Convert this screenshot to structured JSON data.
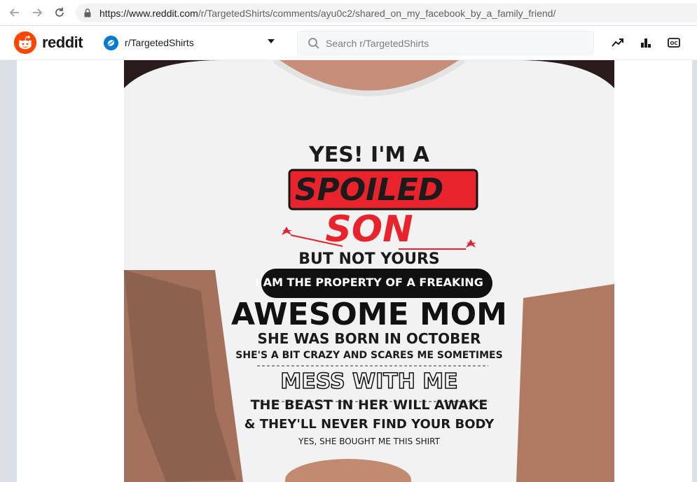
{
  "browser": {
    "url_host": "https://www.reddit.com",
    "url_path": "/r/TargetedShirts/comments/ayu0c2/shared_on_my_facebook_by_a_family_friend/"
  },
  "header": {
    "logo_text": "reddit",
    "community_name": "r/TargetedShirts",
    "search_placeholder": "Search r/TargetedShirts",
    "icons": [
      "trending-icon",
      "leaderboard-icon",
      "oc-icon"
    ],
    "oc_label": "OC"
  },
  "post": {
    "image_alt": "T-shirt photo",
    "shirt": {
      "line1": "YES! I'M A",
      "line2": "SPOILED",
      "line3": "SON",
      "line4": "BUT NOT YOURS",
      "line5": "I AM THE PROPERTY OF A FREAKING",
      "line6": "AWESOME MOM",
      "line7": "SHE WAS BORN IN OCTOBER",
      "line8": "SHE'S A BIT CRAZY AND SCARES ME SOMETIMES",
      "line9": "MESS WITH ME",
      "line10": "THE BEAST IN HER WILL AWAKE",
      "line11": "& THEY'LL NEVER FIND YOUR BODY",
      "line12": "YES, SHE BOUGHT ME THIS SHIRT"
    }
  },
  "colors": {
    "reddit_orange": "#ff4500",
    "community_blue": "#0079d3",
    "shirt_red": "#e8232b"
  }
}
